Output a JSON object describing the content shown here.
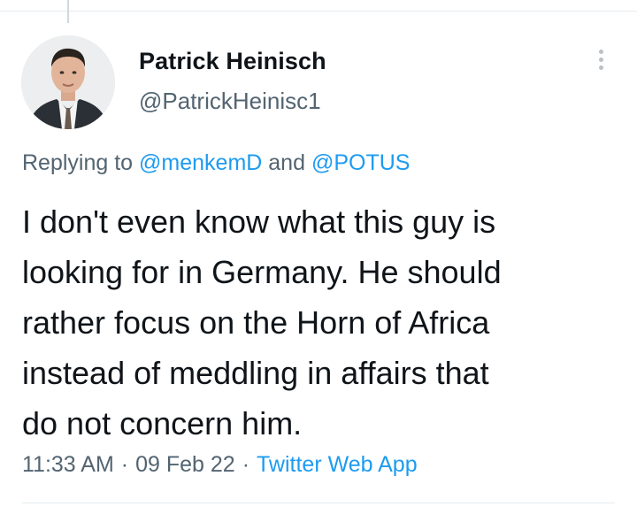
{
  "tweet": {
    "author": {
      "display_name": "Patrick Heinisch",
      "handle": "@PatrickHeinisc1",
      "avatar_icon": "profile-photo"
    },
    "more_icon": "more-vertical-icon",
    "replying_to": {
      "prefix": "Replying to",
      "users": [
        "@menkemD",
        "@POTUS"
      ],
      "conjunction": "and"
    },
    "text_lines": [
      "I don't even know what this guy is",
      "looking for in Germany. He should",
      "rather focus on the Horn of Africa",
      "instead of meddling in affairs that",
      "do not concern him."
    ],
    "meta": {
      "time": "11:33 AM",
      "separator": "·",
      "date": "09 Feb 22",
      "source": "Twitter Web App"
    }
  },
  "colors": {
    "text_primary": "#0f1419",
    "text_secondary": "#536471",
    "link": "#1d9bf0",
    "divider": "#e6ecf0"
  }
}
